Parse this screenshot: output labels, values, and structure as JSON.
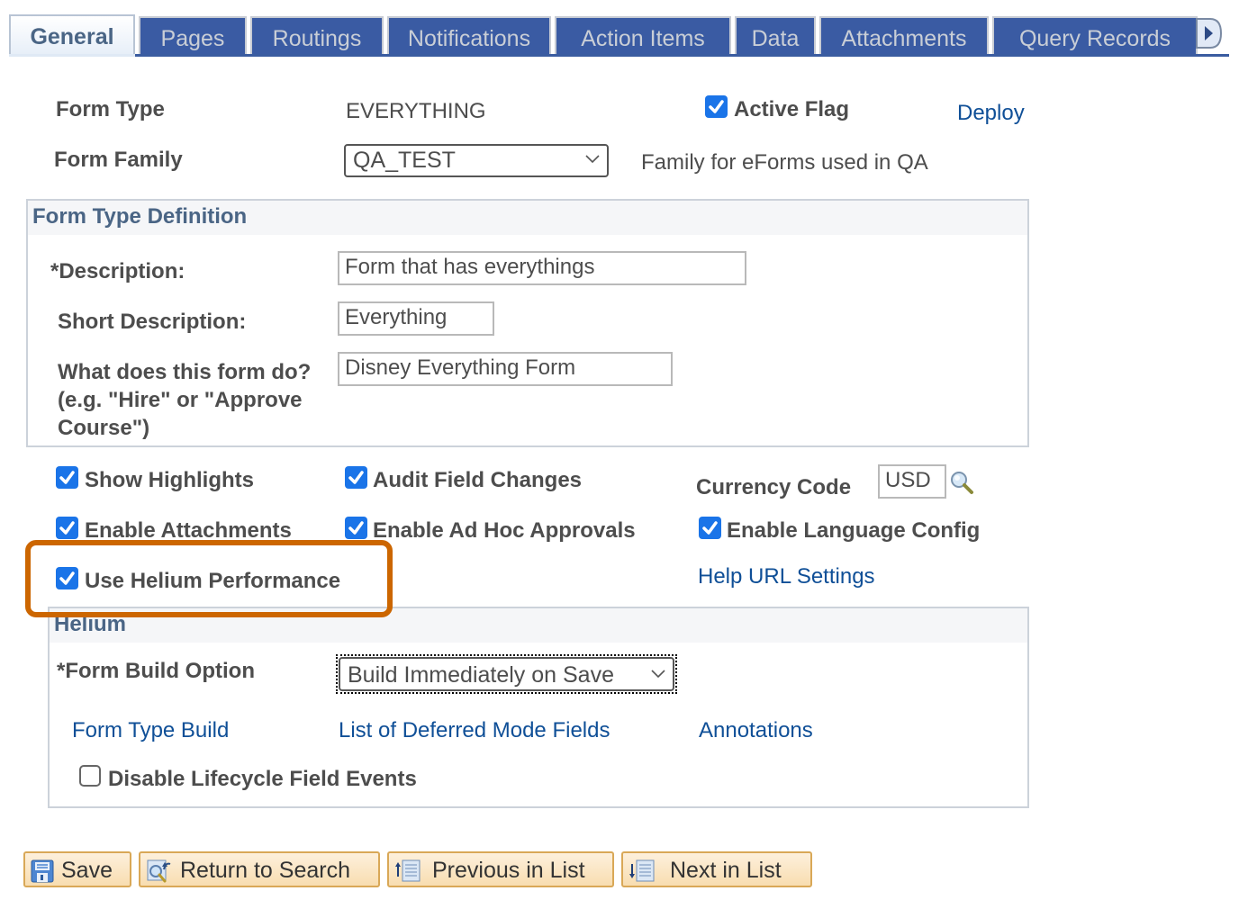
{
  "tabs": [
    {
      "label": "General",
      "active": true
    },
    {
      "label": "Pages",
      "active": false
    },
    {
      "label": "Routings",
      "active": false
    },
    {
      "label": "Notifications",
      "active": false
    },
    {
      "label": "Action Items",
      "active": false
    },
    {
      "label": "Data",
      "active": false
    },
    {
      "label": "Attachments",
      "active": false
    },
    {
      "label": "Query Records",
      "active": false
    }
  ],
  "tab_scroll_icon": "scroll-right-icon",
  "header": {
    "form_type_label": "Form Type",
    "form_type_value": "EVERYTHING",
    "active_flag_label": "Active Flag",
    "active_flag_checked": true,
    "deploy_link": "Deploy",
    "form_family_label": "Form Family",
    "form_family_value": "QA_TEST",
    "form_family_description": "Family for eForms used in QA"
  },
  "definition": {
    "title": "Form Type Definition",
    "description_label": "*Description:",
    "description_value": "Form that has everythings",
    "short_description_label": "Short Description:",
    "short_description_value": "Everything",
    "what_does_label_1": "What does this form do?",
    "what_does_label_2": "(e.g. \"Hire\" or \"Approve",
    "what_does_label_3": "Course\")",
    "what_does_value": "Disney Everything Form"
  },
  "options": {
    "show_highlights": {
      "label": "Show Highlights",
      "checked": true
    },
    "audit_field_changes": {
      "label": "Audit Field Changes",
      "checked": true
    },
    "currency_code_label": "Currency Code",
    "currency_code_value": "USD",
    "enable_attachments": {
      "label": "Enable Attachments",
      "checked": true
    },
    "enable_ad_hoc_approvals": {
      "label": "Enable Ad Hoc Approvals",
      "checked": true
    },
    "enable_language_config": {
      "label": "Enable Language Config",
      "checked": true
    },
    "use_helium_performance": {
      "label": "Use Helium Performance",
      "checked": true
    },
    "help_url_settings_link": "Help URL Settings"
  },
  "helium": {
    "title": "Helium",
    "form_build_option_label": "*Form Build Option",
    "form_build_option_value": "Build Immediately on Save",
    "form_type_build_link": "Form Type Build",
    "deferred_fields_link": "List of Deferred Mode Fields",
    "annotations_link": "Annotations",
    "disable_lifecycle": {
      "label": "Disable Lifecycle Field Events",
      "checked": false
    }
  },
  "buttons": {
    "save": "Save",
    "return_to_search": "Return to Search",
    "previous_in_list": "Previous in List",
    "next_in_list": "Next in List"
  },
  "colors": {
    "tab_blue": "#3a5ba3",
    "link_blue": "#0f4f97",
    "checkbox_blue": "#1a74e8",
    "highlight_orange": "#cc6600",
    "button_border": "#d9a857"
  }
}
